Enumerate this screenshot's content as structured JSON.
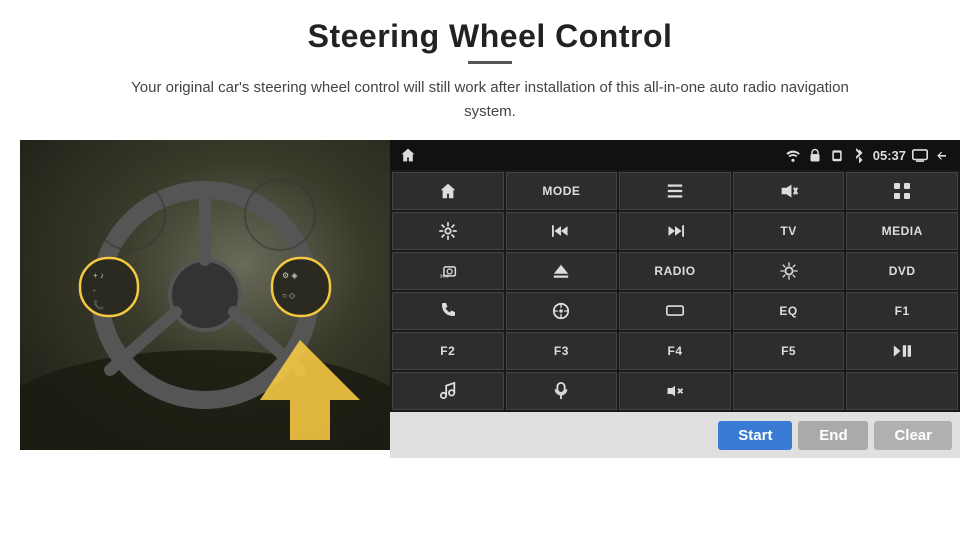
{
  "header": {
    "title": "Steering Wheel Control",
    "subtitle": "Your original car's steering wheel control will still work after installation of this all-in-one auto radio navigation system."
  },
  "status_bar": {
    "time": "05:37",
    "icons": [
      "wifi",
      "lock",
      "sim",
      "bluetooth",
      "screen",
      "back"
    ]
  },
  "buttons": [
    {
      "id": "home",
      "icon": "home",
      "type": "icon"
    },
    {
      "id": "mode",
      "label": "MODE",
      "type": "text"
    },
    {
      "id": "list",
      "icon": "list",
      "type": "icon"
    },
    {
      "id": "mute",
      "icon": "mute",
      "type": "icon"
    },
    {
      "id": "apps",
      "icon": "apps",
      "type": "icon"
    },
    {
      "id": "settings",
      "icon": "settings",
      "type": "icon"
    },
    {
      "id": "prev",
      "icon": "prev",
      "type": "icon"
    },
    {
      "id": "next",
      "icon": "next",
      "type": "icon"
    },
    {
      "id": "tv",
      "label": "TV",
      "type": "text"
    },
    {
      "id": "media",
      "label": "MEDIA",
      "type": "text"
    },
    {
      "id": "cam360",
      "icon": "360",
      "type": "icon"
    },
    {
      "id": "eject",
      "icon": "eject",
      "type": "icon"
    },
    {
      "id": "radio",
      "label": "RADIO",
      "type": "text"
    },
    {
      "id": "bright",
      "icon": "brightness",
      "type": "icon"
    },
    {
      "id": "dvd",
      "label": "DVD",
      "type": "text"
    },
    {
      "id": "phone",
      "icon": "phone",
      "type": "icon"
    },
    {
      "id": "navi",
      "icon": "navi",
      "type": "icon"
    },
    {
      "id": "screen",
      "icon": "screen",
      "type": "icon"
    },
    {
      "id": "eq",
      "label": "EQ",
      "type": "text"
    },
    {
      "id": "f1",
      "label": "F1",
      "type": "text"
    },
    {
      "id": "f2",
      "label": "F2",
      "type": "text"
    },
    {
      "id": "f3",
      "label": "F3",
      "type": "text"
    },
    {
      "id": "f4",
      "label": "F4",
      "type": "text"
    },
    {
      "id": "f5",
      "label": "F5",
      "type": "text"
    },
    {
      "id": "playpause",
      "icon": "playpause",
      "type": "icon"
    },
    {
      "id": "music",
      "icon": "music",
      "type": "icon"
    },
    {
      "id": "mic",
      "icon": "mic",
      "type": "icon"
    },
    {
      "id": "volmute",
      "icon": "volmute",
      "type": "icon"
    },
    {
      "id": "empty1",
      "label": "",
      "type": "text"
    },
    {
      "id": "empty2",
      "label": "",
      "type": "text"
    }
  ],
  "action_bar": {
    "start_label": "Start",
    "end_label": "End",
    "clear_label": "Clear"
  }
}
